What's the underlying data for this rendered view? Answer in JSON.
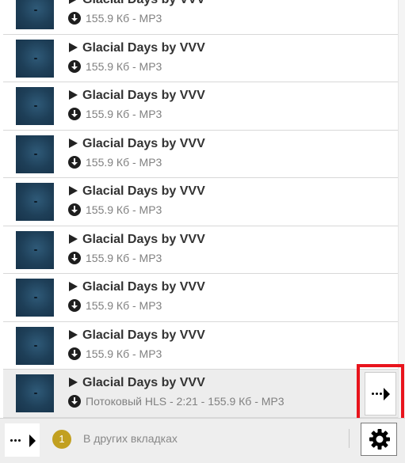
{
  "tracks": [
    {
      "title": "Glacial Days by VVV",
      "meta": "155.9 Кб - MP3"
    },
    {
      "title": "Glacial Days by VVV",
      "meta": "155.9 Кб - MP3"
    },
    {
      "title": "Glacial Days by VVV",
      "meta": "155.9 Кб - MP3"
    },
    {
      "title": "Glacial Days by VVV",
      "meta": "155.9 Кб - MP3"
    },
    {
      "title": "Glacial Days by VVV",
      "meta": "155.9 Кб - MP3"
    },
    {
      "title": "Glacial Days by VVV",
      "meta": "155.9 Кб - MP3"
    },
    {
      "title": "Glacial Days by VVV",
      "meta": "155.9 Кб - MP3"
    },
    {
      "title": "Glacial Days by VVV",
      "meta": "155.9 Кб - MP3"
    },
    {
      "title": "Glacial Days by VVV",
      "meta": "Потоковый HLS - 2:21 - 155.9 Кб - MP3"
    }
  ],
  "footer": {
    "badge_count": "1",
    "other_tabs_label": "В других вкладках"
  },
  "colors": {
    "highlight": "#e8141c",
    "badge": "#c2a020"
  },
  "icons": {
    "play": "play-icon",
    "download": "download-icon",
    "more": "more-arrow-icon",
    "settings": "gear-icon"
  }
}
